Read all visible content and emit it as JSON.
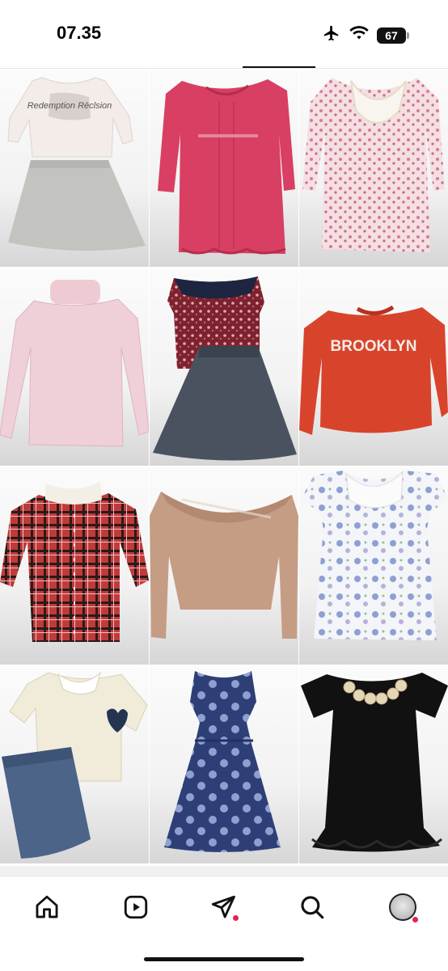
{
  "status_bar": {
    "time": "07.35",
    "battery_level": "67",
    "icons": [
      "airplane-icon",
      "wifi-icon",
      "battery-icon"
    ]
  },
  "grid": {
    "items": [
      {
        "name": "white-tee-grey-skirt",
        "print": "Redemption Rēclsion"
      },
      {
        "name": "pink-ruffle-top",
        "print": ""
      },
      {
        "name": "floral-lace-top",
        "print": ""
      },
      {
        "name": "pink-turtleneck",
        "print": ""
      },
      {
        "name": "floral-top-grey-skirt",
        "print": ""
      },
      {
        "name": "orange-sweatshirt",
        "print": "BROOKLYN"
      },
      {
        "name": "red-plaid-shirt",
        "print": ""
      },
      {
        "name": "tan-vneck-top",
        "print": ""
      },
      {
        "name": "blue-floral-blouse",
        "print": ""
      },
      {
        "name": "heart-blouse-denim-skirt",
        "print": ""
      },
      {
        "name": "navy-polka-dot-dress",
        "print": ""
      },
      {
        "name": "black-dress-beaded-collar",
        "print": ""
      }
    ]
  },
  "bottom_nav": {
    "items": [
      "home-icon",
      "reels-icon",
      "send-icon",
      "search-icon",
      "profile-avatar"
    ],
    "notification_color": "#e0234f"
  }
}
